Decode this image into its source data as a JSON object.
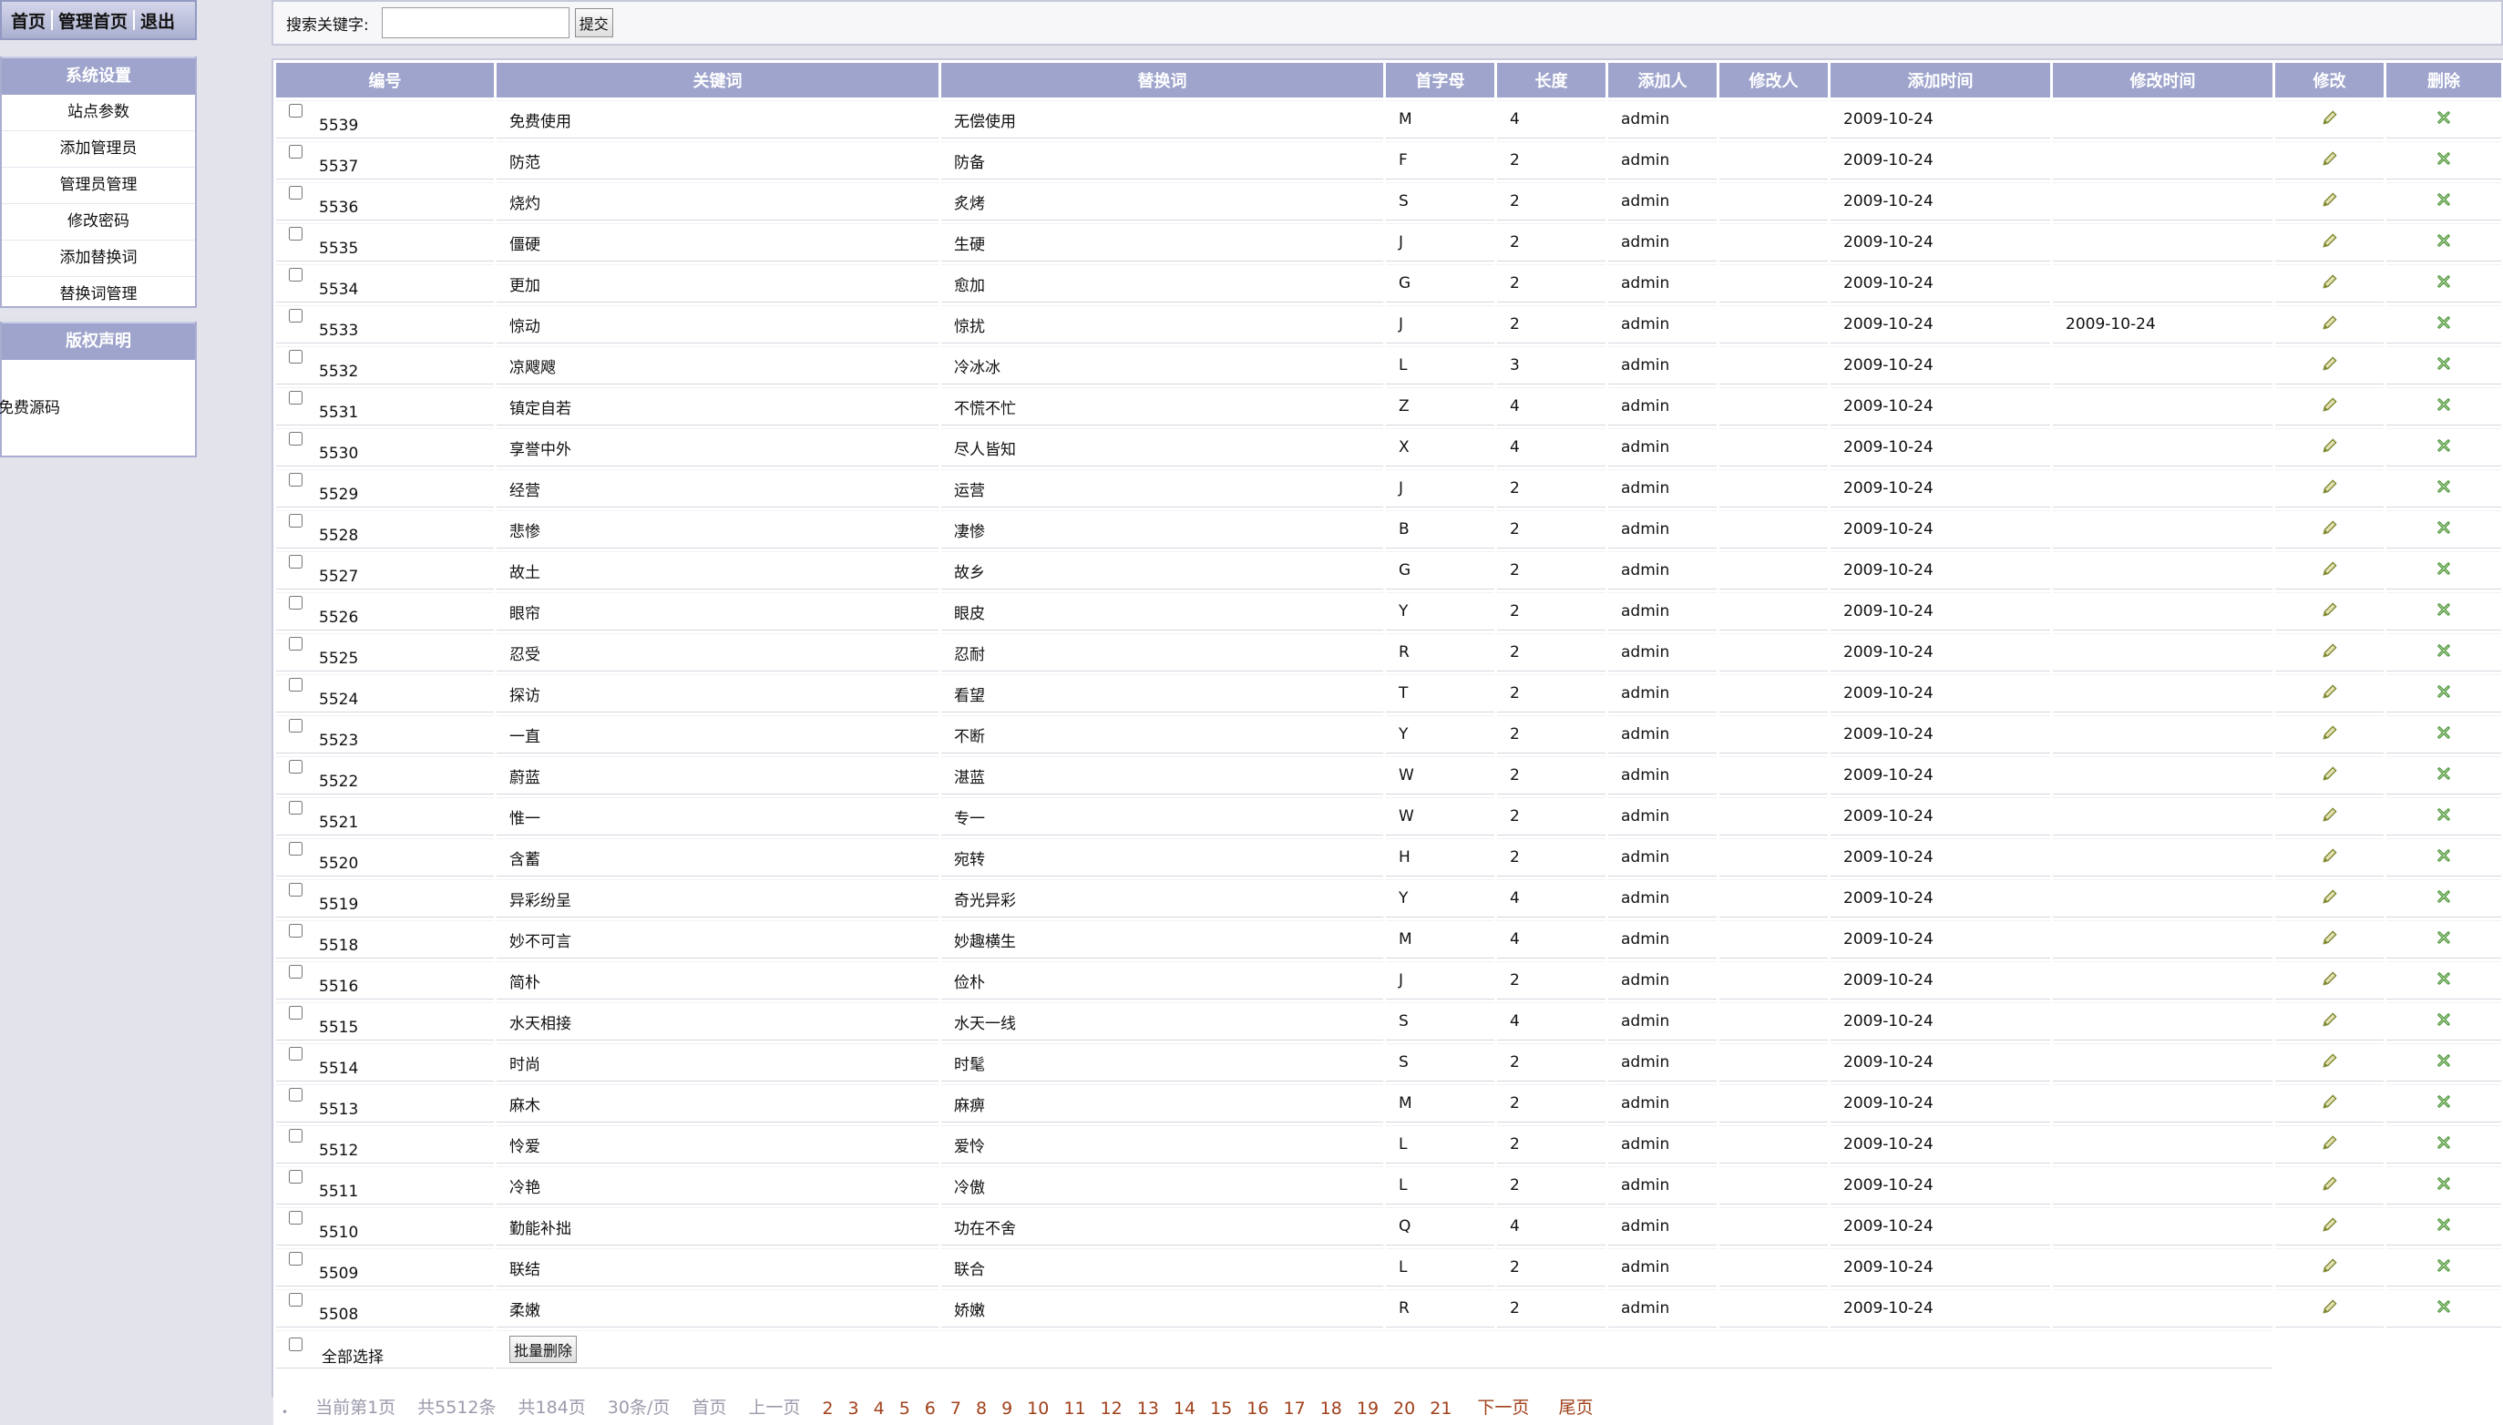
{
  "topnav": {
    "home": "首页",
    "admin_home": "管理首页",
    "logout": "退出"
  },
  "sidebar": {
    "system_title": "系统设置",
    "items": [
      "站点参数",
      "添加管理员",
      "管理员管理",
      "修改密码",
      "添加替换词",
      "替换词管理"
    ],
    "copyright_title": "版权声明",
    "copyright_text": "免费源码"
  },
  "search": {
    "label": "搜索关键字:",
    "value": "",
    "submit": "提交"
  },
  "table": {
    "headers": [
      "编号",
      "关键词",
      "替换词",
      "首字母",
      "长度",
      "添加人",
      "修改人",
      "添加时间",
      "修改时间",
      "修改",
      "删除"
    ],
    "rows": [
      {
        "id": "5539",
        "keyword": "免费使用",
        "replace": "无偿使用",
        "initial": "M",
        "length": "4",
        "added_by": "admin",
        "modified_by": "",
        "added_at": "2009-10-24",
        "modified_at": ""
      },
      {
        "id": "5537",
        "keyword": "防范",
        "replace": "防备",
        "initial": "F",
        "length": "2",
        "added_by": "admin",
        "modified_by": "",
        "added_at": "2009-10-24",
        "modified_at": ""
      },
      {
        "id": "5536",
        "keyword": "烧灼",
        "replace": "炙烤",
        "initial": "S",
        "length": "2",
        "added_by": "admin",
        "modified_by": "",
        "added_at": "2009-10-24",
        "modified_at": ""
      },
      {
        "id": "5535",
        "keyword": "僵硬",
        "replace": "生硬",
        "initial": "J",
        "length": "2",
        "added_by": "admin",
        "modified_by": "",
        "added_at": "2009-10-24",
        "modified_at": ""
      },
      {
        "id": "5534",
        "keyword": "更加",
        "replace": "愈加",
        "initial": "G",
        "length": "2",
        "added_by": "admin",
        "modified_by": "",
        "added_at": "2009-10-24",
        "modified_at": ""
      },
      {
        "id": "5533",
        "keyword": "惊动",
        "replace": "惊扰",
        "initial": "J",
        "length": "2",
        "added_by": "admin",
        "modified_by": "",
        "added_at": "2009-10-24",
        "modified_at": "2009-10-24"
      },
      {
        "id": "5532",
        "keyword": "凉飕飕",
        "replace": "冷冰冰",
        "initial": "L",
        "length": "3",
        "added_by": "admin",
        "modified_by": "",
        "added_at": "2009-10-24",
        "modified_at": ""
      },
      {
        "id": "5531",
        "keyword": "镇定自若",
        "replace": "不慌不忙",
        "initial": "Z",
        "length": "4",
        "added_by": "admin",
        "modified_by": "",
        "added_at": "2009-10-24",
        "modified_at": ""
      },
      {
        "id": "5530",
        "keyword": "享誉中外",
        "replace": "尽人皆知",
        "initial": "X",
        "length": "4",
        "added_by": "admin",
        "modified_by": "",
        "added_at": "2009-10-24",
        "modified_at": ""
      },
      {
        "id": "5529",
        "keyword": "经营",
        "replace": "运营",
        "initial": "J",
        "length": "2",
        "added_by": "admin",
        "modified_by": "",
        "added_at": "2009-10-24",
        "modified_at": ""
      },
      {
        "id": "5528",
        "keyword": "悲惨",
        "replace": "凄惨",
        "initial": "B",
        "length": "2",
        "added_by": "admin",
        "modified_by": "",
        "added_at": "2009-10-24",
        "modified_at": ""
      },
      {
        "id": "5527",
        "keyword": "故土",
        "replace": "故乡",
        "initial": "G",
        "length": "2",
        "added_by": "admin",
        "modified_by": "",
        "added_at": "2009-10-24",
        "modified_at": ""
      },
      {
        "id": "5526",
        "keyword": "眼帘",
        "replace": "眼皮",
        "initial": "Y",
        "length": "2",
        "added_by": "admin",
        "modified_by": "",
        "added_at": "2009-10-24",
        "modified_at": ""
      },
      {
        "id": "5525",
        "keyword": "忍受",
        "replace": "忍耐",
        "initial": "R",
        "length": "2",
        "added_by": "admin",
        "modified_by": "",
        "added_at": "2009-10-24",
        "modified_at": ""
      },
      {
        "id": "5524",
        "keyword": "探访",
        "replace": "看望",
        "initial": "T",
        "length": "2",
        "added_by": "admin",
        "modified_by": "",
        "added_at": "2009-10-24",
        "modified_at": ""
      },
      {
        "id": "5523",
        "keyword": "一直",
        "replace": "不断",
        "initial": "Y",
        "length": "2",
        "added_by": "admin",
        "modified_by": "",
        "added_at": "2009-10-24",
        "modified_at": ""
      },
      {
        "id": "5522",
        "keyword": "蔚蓝",
        "replace": "湛蓝",
        "initial": "W",
        "length": "2",
        "added_by": "admin",
        "modified_by": "",
        "added_at": "2009-10-24",
        "modified_at": ""
      },
      {
        "id": "5521",
        "keyword": "惟一",
        "replace": "专一",
        "initial": "W",
        "length": "2",
        "added_by": "admin",
        "modified_by": "",
        "added_at": "2009-10-24",
        "modified_at": ""
      },
      {
        "id": "5520",
        "keyword": "含蓄",
        "replace": "宛转",
        "initial": "H",
        "length": "2",
        "added_by": "admin",
        "modified_by": "",
        "added_at": "2009-10-24",
        "modified_at": ""
      },
      {
        "id": "5519",
        "keyword": "异彩纷呈",
        "replace": "奇光异彩",
        "initial": "Y",
        "length": "4",
        "added_by": "admin",
        "modified_by": "",
        "added_at": "2009-10-24",
        "modified_at": ""
      },
      {
        "id": "5518",
        "keyword": "妙不可言",
        "replace": "妙趣横生",
        "initial": "M",
        "length": "4",
        "added_by": "admin",
        "modified_by": "",
        "added_at": "2009-10-24",
        "modified_at": ""
      },
      {
        "id": "5516",
        "keyword": "简朴",
        "replace": "俭朴",
        "initial": "J",
        "length": "2",
        "added_by": "admin",
        "modified_by": "",
        "added_at": "2009-10-24",
        "modified_at": ""
      },
      {
        "id": "5515",
        "keyword": "水天相接",
        "replace": "水天一线",
        "initial": "S",
        "length": "4",
        "added_by": "admin",
        "modified_by": "",
        "added_at": "2009-10-24",
        "modified_at": ""
      },
      {
        "id": "5514",
        "keyword": "时尚",
        "replace": "时髦",
        "initial": "S",
        "length": "2",
        "added_by": "admin",
        "modified_by": "",
        "added_at": "2009-10-24",
        "modified_at": ""
      },
      {
        "id": "5513",
        "keyword": "麻木",
        "replace": "麻痹",
        "initial": "M",
        "length": "2",
        "added_by": "admin",
        "modified_by": "",
        "added_at": "2009-10-24",
        "modified_at": ""
      },
      {
        "id": "5512",
        "keyword": "怜爱",
        "replace": "爱怜",
        "initial": "L",
        "length": "2",
        "added_by": "admin",
        "modified_by": "",
        "added_at": "2009-10-24",
        "modified_at": ""
      },
      {
        "id": "5511",
        "keyword": "冷艳",
        "replace": "冷傲",
        "initial": "L",
        "length": "2",
        "added_by": "admin",
        "modified_by": "",
        "added_at": "2009-10-24",
        "modified_at": ""
      },
      {
        "id": "5510",
        "keyword": "勤能补拙",
        "replace": "功在不舍",
        "initial": "Q",
        "length": "4",
        "added_by": "admin",
        "modified_by": "",
        "added_at": "2009-10-24",
        "modified_at": ""
      },
      {
        "id": "5509",
        "keyword": "联结",
        "replace": "联合",
        "initial": "L",
        "length": "2",
        "added_by": "admin",
        "modified_by": "",
        "added_at": "2009-10-24",
        "modified_at": ""
      },
      {
        "id": "5508",
        "keyword": "柔嫩",
        "replace": "娇嫩",
        "initial": "R",
        "length": "2",
        "added_by": "admin",
        "modified_by": "",
        "added_at": "2009-10-24",
        "modified_at": ""
      }
    ],
    "select_all": "全部选择",
    "batch_delete": "批量删除"
  },
  "pager": {
    "dot": "•",
    "current": "当前第1页",
    "total_records": "共5512条",
    "total_pages": "共184页",
    "per_page": "30条/页",
    "first": "首页",
    "prev": "上一页",
    "pages": [
      "2",
      "3",
      "4",
      "5",
      "6",
      "7",
      "8",
      "9",
      "10",
      "11",
      "12",
      "13",
      "14",
      "15",
      "16",
      "17",
      "18",
      "19",
      "20",
      "21"
    ],
    "next": "下一页",
    "last": "尾页"
  },
  "colors": {
    "header_bg": "#9ea4cc",
    "page_bg": "#e3e3ec",
    "link": "#a0401b",
    "edit_icon": "#7d8a33",
    "delete_icon": "#3f8a2c"
  },
  "icons": {
    "edit": "pencil-icon",
    "delete": "cross-icon"
  }
}
